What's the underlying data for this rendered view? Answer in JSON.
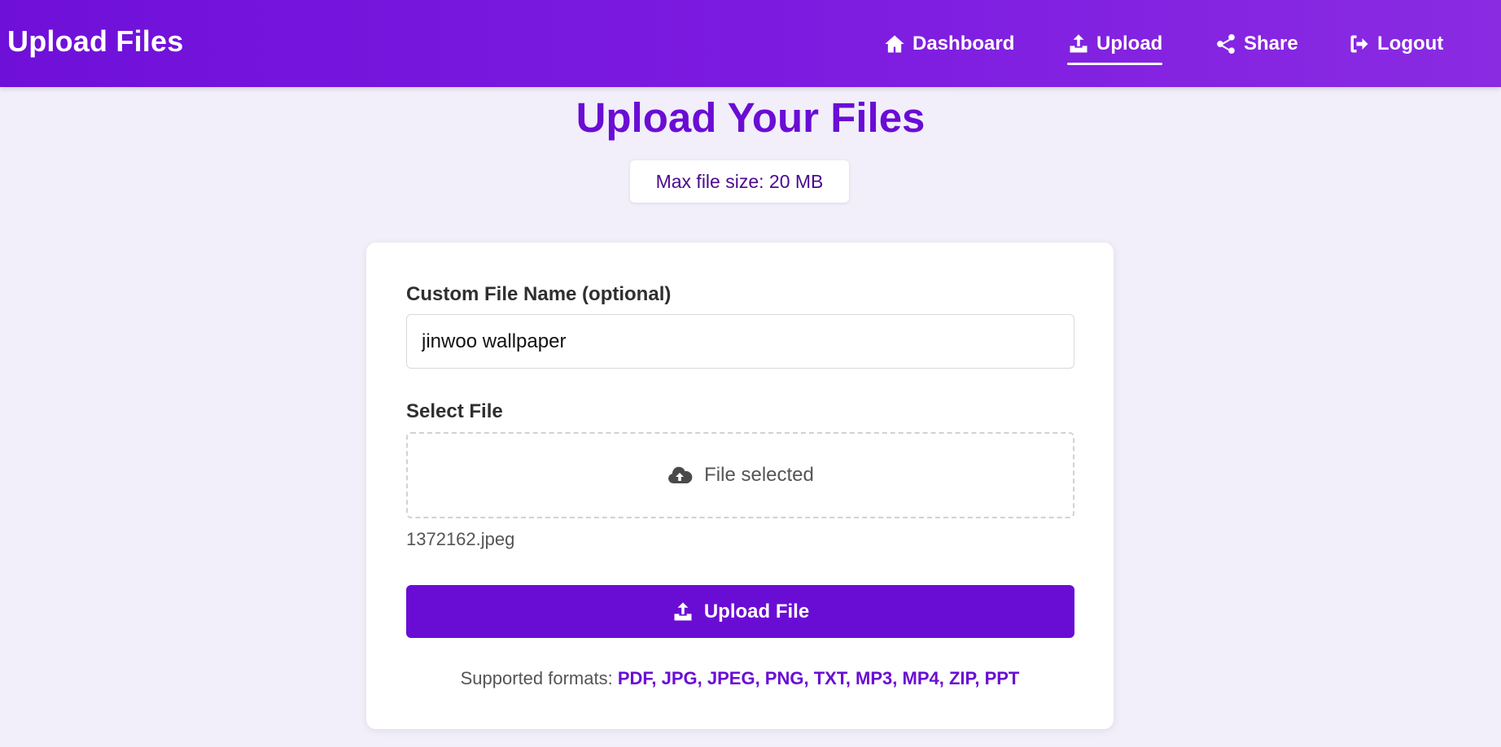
{
  "header": {
    "brand": "Upload Files",
    "nav": [
      {
        "label": "Dashboard",
        "icon": "home-icon"
      },
      {
        "label": "Upload",
        "icon": "upload-icon",
        "active": true
      },
      {
        "label": "Share",
        "icon": "share-icon"
      },
      {
        "label": "Logout",
        "icon": "logout-icon"
      }
    ]
  },
  "main": {
    "title": "Upload Your Files",
    "max_size": "Max file size: 20 MB"
  },
  "form": {
    "name_label": "Custom File Name (optional)",
    "name_value": "jinwoo wallpaper",
    "file_label": "Select File",
    "dropzone_text": "File selected",
    "dropzone_icon": "cloud-upload-icon",
    "selected_file": "1372162.jpeg",
    "submit_label": "Upload File",
    "formats_prefix": "Supported formats:",
    "formats_list": "PDF, JPG, JPEG, PNG, TXT, MP3, MP4, ZIP, PPT"
  },
  "colors": {
    "accent": "#6a0dd4",
    "header_start": "#6f10d9",
    "header_end": "#8a2be2",
    "background": "#f2eefa"
  }
}
